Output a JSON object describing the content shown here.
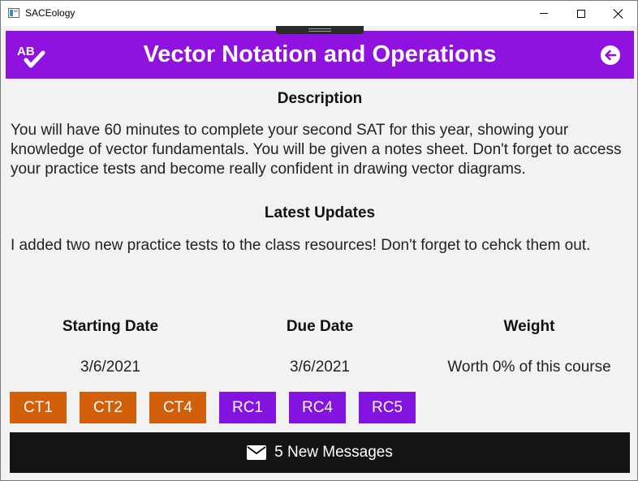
{
  "window": {
    "title": "SACEology"
  },
  "header": {
    "title": "Vector Notation and Operations",
    "logo_icon": "ab-check-icon",
    "back_icon": "arrow-left-circle-icon",
    "color": "#9012df"
  },
  "description": {
    "heading": "Description",
    "text": "You will have 60 minutes to complete your second SAT for this year, showing your knowledge of vector fundamentals. You will be given a notes sheet. Don't forget to access your practice tests and become really confident in drawing vector diagrams."
  },
  "updates": {
    "heading": "Latest Updates",
    "text": "I added two new practice tests to the class resources! Don't forget to cehck them out."
  },
  "details": {
    "starting_date": {
      "label": "Starting Date",
      "value": "3/6/2021"
    },
    "due_date": {
      "label": "Due Date",
      "value": "3/6/2021"
    },
    "weight": {
      "label": "Weight",
      "value": "Worth 0% of this course"
    }
  },
  "tests": [
    {
      "label": "CT1",
      "kind": "ct",
      "color": "#d2600b"
    },
    {
      "label": "CT2",
      "kind": "ct",
      "color": "#d2600b"
    },
    {
      "label": "CT4",
      "kind": "ct",
      "color": "#d2600b"
    },
    {
      "label": "RC1",
      "kind": "rc",
      "color": "#8313df"
    },
    {
      "label": "RC4",
      "kind": "rc",
      "color": "#8313df"
    },
    {
      "label": "RC5",
      "kind": "rc",
      "color": "#8313df"
    }
  ],
  "messages": {
    "label": "5 New Messages",
    "icon": "envelope-icon"
  }
}
